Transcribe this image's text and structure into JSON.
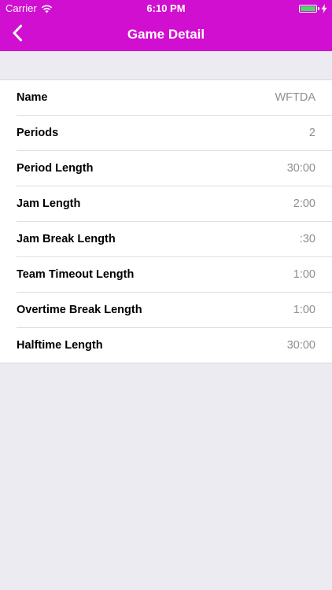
{
  "status_bar": {
    "carrier": "Carrier",
    "time": "6:10 PM",
    "battery_color": "#4cd964"
  },
  "nav": {
    "title": "Game Detail",
    "back_icon": "chevron-left-icon",
    "color": "#d10fd0"
  },
  "rows": [
    {
      "label": "Name",
      "value": "WFTDA"
    },
    {
      "label": "Periods",
      "value": "2"
    },
    {
      "label": "Period Length",
      "value": "30:00"
    },
    {
      "label": "Jam Length",
      "value": "2:00"
    },
    {
      "label": "Jam Break Length",
      "value": ":30"
    },
    {
      "label": "Team Timeout Length",
      "value": "1:00"
    },
    {
      "label": "Overtime Break Length",
      "value": "1:00"
    },
    {
      "label": "Halftime Length",
      "value": "30:00"
    }
  ]
}
